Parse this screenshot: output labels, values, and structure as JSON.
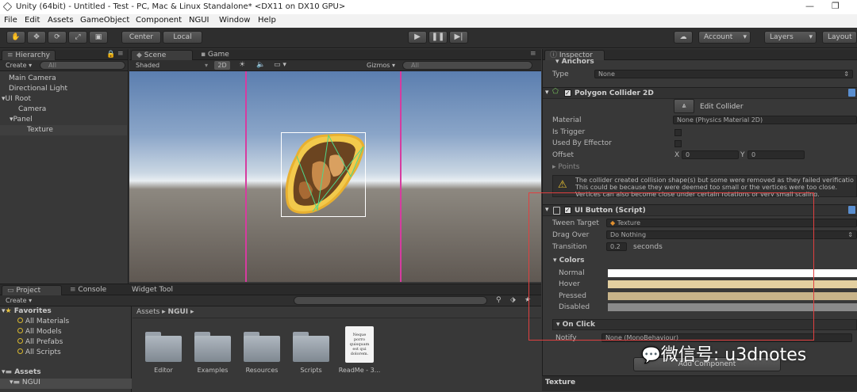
{
  "window": {
    "title": "Unity (64bit) - Untitled - Test - PC, Mac & Linux Standalone* <DX11 on DX10 GPU>"
  },
  "menu": [
    "File",
    "Edit",
    "Assets",
    "GameObject",
    "Component",
    "NGUI",
    "Window",
    "Help"
  ],
  "toolbar": {
    "center": "Center",
    "local": "Local",
    "account": "Account",
    "layers": "Layers",
    "layout": "Layout"
  },
  "hierarchy": {
    "tab": "Hierarchy",
    "create": "Create",
    "search_placeholder": "All",
    "items": [
      "Main Camera",
      "Directional Light",
      "UI Root",
      "Camera",
      "Panel",
      "Texture"
    ]
  },
  "scene": {
    "tab_scene": "Scene",
    "tab_game": "Game",
    "shaded": "Shaded",
    "mode_2d": "2D",
    "gizmos": "Gizmos",
    "search_placeholder": "All"
  },
  "project": {
    "tab_project": "Project",
    "tab_console": "Console",
    "tab_widget": "Widget Tool",
    "create": "Create",
    "favorites_label": "Favorites",
    "favorites": [
      "All Materials",
      "All Models",
      "All Prefabs",
      "All Scripts"
    ],
    "assets_label": "Assets",
    "ngui_label": "NGUI",
    "breadcrumb": [
      "Assets",
      "NGUI"
    ],
    "folders": [
      "Editor",
      "Examples",
      "Resources",
      "Scripts"
    ],
    "readme": "ReadMe - 3...",
    "readme_preview": "Neque porro quisquam est qui dolorem."
  },
  "inspector": {
    "tab": "Inspector",
    "anchors": "Anchors",
    "type_label": "Type",
    "type_value": "None",
    "polygon": {
      "title": "Polygon Collider 2D",
      "edit": "Edit Collider",
      "material_label": "Material",
      "material_value": "None (Physics Material 2D)",
      "trigger_label": "Is Trigger",
      "effector_label": "Used By Effector",
      "offset_label": "Offset",
      "x_label": "X",
      "x_value": "0",
      "y_label": "Y",
      "y_value": "0",
      "points_label": "Points",
      "warning": [
        "The collider created collision shape(s) but some were removed as they failed verificatio",
        "This could be because they were deemed too small or the vertices were too close.",
        "Vertices can also become close under certain rotations or very small scaling."
      ]
    },
    "button": {
      "title": "UI Button (Script)",
      "tween_label": "Tween Target",
      "tween_value": "Texture",
      "drag_label": "Drag Over",
      "drag_value": "Do Nothing",
      "transition_label": "Transition",
      "transition_value": "0.2",
      "seconds": "seconds",
      "colors": "Colors",
      "normal": "Normal",
      "hover": "Hover",
      "pressed": "Pressed",
      "disabled": "Disabled",
      "onclick": "On Click",
      "notify_label": "Notify",
      "notify_value": "None (MonoBehaviour)"
    },
    "add_component": "Add Component",
    "footer": "Texture",
    "color_values": {
      "normal": "#ffffff",
      "hover": "#e3cfa0",
      "pressed": "#c8b48a",
      "disabled": "#8a8a8a"
    }
  },
  "watermark": "微信号: u3dnotes"
}
